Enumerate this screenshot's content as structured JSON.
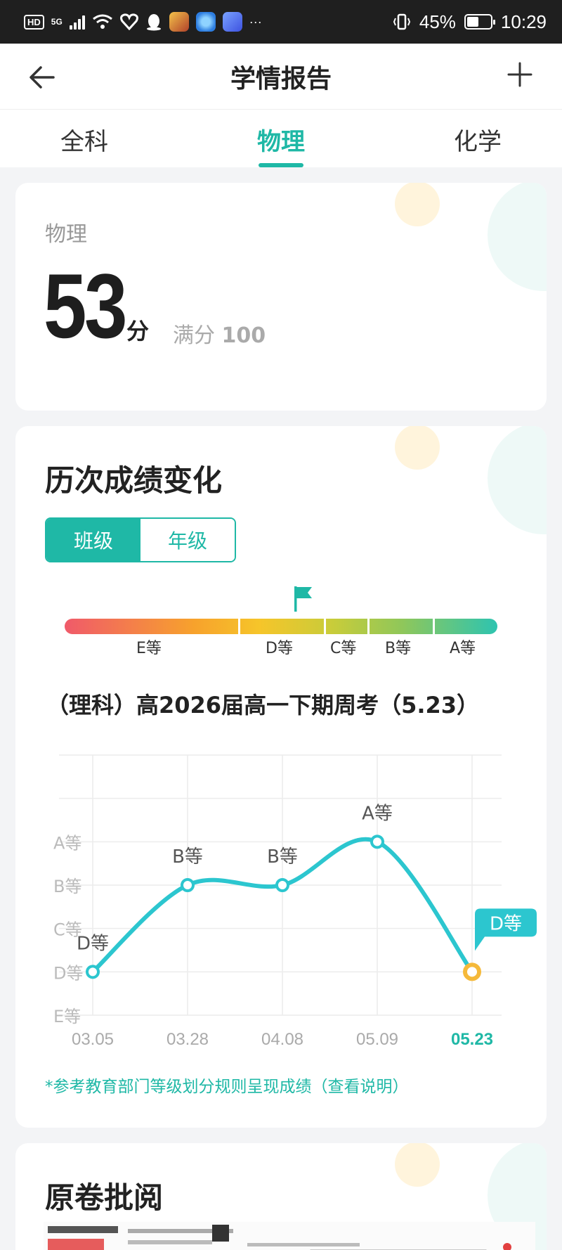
{
  "status_bar": {
    "hd": "HD",
    "net": "5G",
    "more": "···",
    "battery": "45%",
    "time": "10:29"
  },
  "header": {
    "title": "学情报告"
  },
  "tabs": [
    {
      "label": "全科",
      "active": false
    },
    {
      "label": "物理",
      "active": true
    },
    {
      "label": "化学",
      "active": false
    }
  ],
  "score": {
    "subject": "物理",
    "value": "53",
    "unit": "分",
    "full_label": "满分",
    "full_value": "100"
  },
  "trend": {
    "title": "历次成绩变化",
    "toggle": {
      "class_label": "班级",
      "grade_label": "年级",
      "selected": "班级"
    },
    "grade_scale": [
      "E等",
      "D等",
      "C等",
      "B等",
      "A等"
    ],
    "current_grade": "D等",
    "exam_title": "（理科）高2026届高一下期周考（5.23）",
    "note": "*参考教育部门等级划分规则呈现成绩（查看说明）"
  },
  "paper": {
    "title": "原卷批阅"
  },
  "chart_data": {
    "type": "line",
    "y_categories": [
      "E等",
      "D等",
      "C等",
      "B等",
      "A等"
    ],
    "x": [
      "03.05",
      "03.28",
      "04.08",
      "05.09",
      "05.23"
    ],
    "series": [
      {
        "values": [
          "D等",
          "B等",
          "B等",
          "A等",
          "D等"
        ]
      }
    ],
    "point_labels": [
      "D等",
      "B等",
      "B等",
      "A等",
      "D等"
    ],
    "highlight_index": 4,
    "colors": {
      "line": "#2cc6cf",
      "highlight": "#f5b93a",
      "accent": "#1fb8a6"
    }
  }
}
